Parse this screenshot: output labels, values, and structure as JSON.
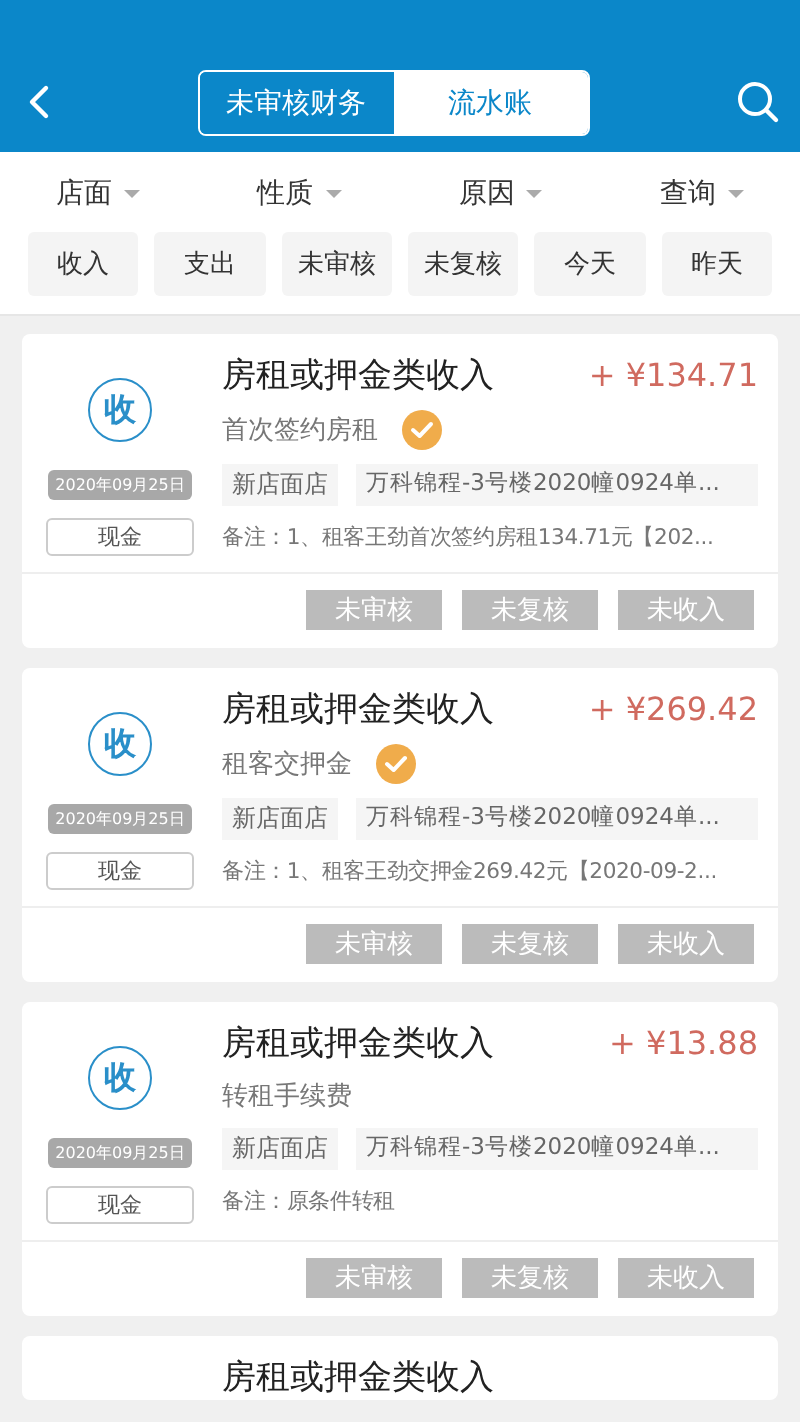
{
  "header": {
    "segments": [
      {
        "label": "未审核财务",
        "selected": true
      },
      {
        "label": "流水账",
        "selected": false
      }
    ]
  },
  "filters": [
    "店面",
    "性质",
    "原因",
    "查询"
  ],
  "chips": [
    "收入",
    "支出",
    "未审核",
    "未复核",
    "今天",
    "昨天"
  ],
  "records": [
    {
      "badge": "收",
      "title": "房租或押金类收入",
      "amount": "+ ¥134.71",
      "subtitle": "首次签约房租",
      "verified": true,
      "date": "2020年09月25日",
      "payment": "现金",
      "store": "新店面店",
      "address": "万科锦程-3号楼2020幢0924单...",
      "remark": "备注：1、租客王劲首次签约房租134.71元【202...",
      "statuses": [
        "未审核",
        "未复核",
        "未收入"
      ]
    },
    {
      "badge": "收",
      "title": "房租或押金类收入",
      "amount": "+ ¥269.42",
      "subtitle": "租客交押金",
      "verified": true,
      "date": "2020年09月25日",
      "payment": "现金",
      "store": "新店面店",
      "address": "万科锦程-3号楼2020幢0924单...",
      "remark": "备注：1、租客王劲交押金269.42元【2020-09-2...",
      "statuses": [
        "未审核",
        "未复核",
        "未收入"
      ]
    },
    {
      "badge": "收",
      "title": "房租或押金类收入",
      "amount": "+ ¥13.88",
      "subtitle": "转租手续费",
      "verified": false,
      "date": "2020年09月25日",
      "payment": "现金",
      "store": "新店面店",
      "address": "万科锦程-3号楼2020幢0924单...",
      "remark": "备注：原条件转租",
      "statuses": [
        "未审核",
        "未复核",
        "未收入"
      ]
    },
    {
      "title": "房租或押金类收入"
    }
  ]
}
